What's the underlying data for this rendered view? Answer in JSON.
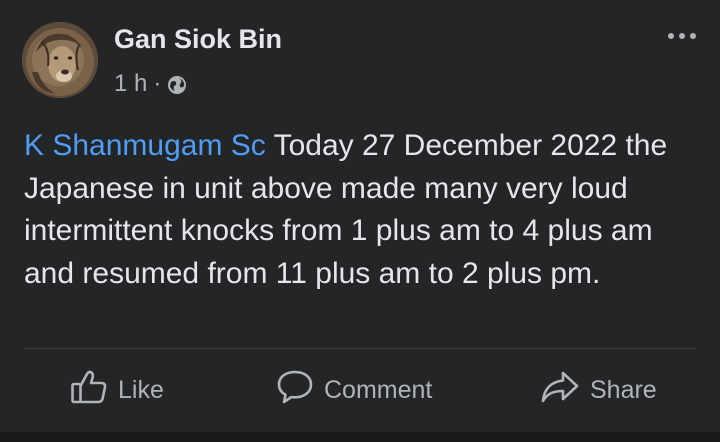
{
  "post": {
    "author": "Gan Siok Bin",
    "time": "1 h",
    "separator": "·",
    "visibility_icon": "globe-icon",
    "more_icon": "more-options-icon",
    "mention": "K Shanmugam Sc",
    "body": " Today 27 December 2022 the Japanese in unit above made many very loud intermittent knocks from 1 plus am to 4 plus am and resumed from 11 plus am to 2 plus pm."
  },
  "actions": {
    "like_label": "Like",
    "comment_label": "Comment",
    "share_label": "Share"
  },
  "colors": {
    "background": "#242526",
    "text": "#e4e6eb",
    "secondary_text": "#b0b3b8",
    "mention": "#4f9df5"
  }
}
